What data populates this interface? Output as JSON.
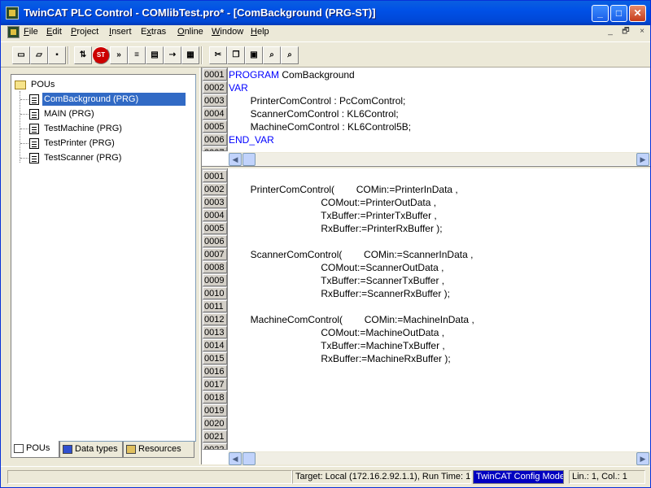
{
  "window": {
    "title": "TwinCAT PLC Control - COMlibTest.pro* - [ComBackground (PRG-ST)]",
    "controls": {
      "minimize": "_",
      "maximize": "□",
      "close": "✕"
    }
  },
  "menu": {
    "items": [
      "File",
      "Edit",
      "Project",
      "Insert",
      "Extras",
      "Online",
      "Window",
      "Help"
    ],
    "mnemonics": [
      "F",
      "E",
      "P",
      "I",
      "x",
      "O",
      "W",
      "H"
    ],
    "mdi_controls": {
      "minimize": "_",
      "restore": "🗗",
      "close": "×"
    }
  },
  "toolbar": {
    "buttons": [
      {
        "name": "new",
        "glyph": "▭"
      },
      {
        "name": "open",
        "glyph": "▱"
      },
      {
        "name": "save",
        "glyph": "▪"
      },
      {
        "name": "login",
        "glyph": "⇅"
      },
      {
        "name": "stop",
        "glyph": "ST"
      },
      {
        "name": "run",
        "glyph": "»"
      },
      {
        "name": "step",
        "glyph": "≡"
      },
      {
        "name": "breakpoint",
        "glyph": "▤"
      },
      {
        "name": "logout",
        "glyph": "⇢"
      },
      {
        "name": "download",
        "glyph": "▦"
      },
      {
        "name": "cut",
        "glyph": "✂"
      },
      {
        "name": "copy",
        "glyph": "❐"
      },
      {
        "name": "paste",
        "glyph": "▣"
      },
      {
        "name": "find",
        "glyph": "⌕"
      },
      {
        "name": "find-next",
        "glyph": "⌕"
      }
    ]
  },
  "tree": {
    "root": "POUs",
    "items": [
      {
        "label": "ComBackground (PRG)",
        "selected": true
      },
      {
        "label": "MAIN (PRG)",
        "selected": false
      },
      {
        "label": "TestMachine (PRG)",
        "selected": false
      },
      {
        "label": "TestPrinter (PRG)",
        "selected": false
      },
      {
        "label": "TestScanner (PRG)",
        "selected": false
      }
    ]
  },
  "tabs": [
    {
      "label": "POUs",
      "active": true
    },
    {
      "label": "Data types",
      "active": false
    },
    {
      "label": "Resources",
      "active": false
    }
  ],
  "declaration": {
    "line_numbers": [
      "0001",
      "0002",
      "0003",
      "0004",
      "0005",
      "0006",
      "0007"
    ],
    "lines": [
      {
        "kw": "PROGRAM",
        "text": " ComBackground"
      },
      {
        "kw": "VAR",
        "text": ""
      },
      {
        "kw": "",
        "text": "        PrinterComControl : PcComControl;"
      },
      {
        "kw": "",
        "text": "        ScannerComControl : KL6Control;"
      },
      {
        "kw": "",
        "text": "        MachineComControl : KL6Control5B;"
      },
      {
        "kw": "END_VAR",
        "text": ""
      },
      {
        "kw": "",
        "text": ""
      }
    ]
  },
  "body": {
    "line_numbers": [
      "0001",
      "0002",
      "0003",
      "0004",
      "0005",
      "0006",
      "0007",
      "0008",
      "0009",
      "0010",
      "0011",
      "0012",
      "0013",
      "0014",
      "0015",
      "0016",
      "0017",
      "0018",
      "0019",
      "0020",
      "0021",
      "0022"
    ],
    "lines": [
      "",
      "        PrinterComControl(        COMin:=PrinterInData ,",
      "                                  COMout:=PrinterOutData ,",
      "                                  TxBuffer:=PrinterTxBuffer ,",
      "                                  RxBuffer:=PrinterRxBuffer );",
      "",
      "        ScannerComControl(        COMin:=ScannerInData ,",
      "                                  COMout:=ScannerOutData ,",
      "                                  TxBuffer:=ScannerTxBuffer ,",
      "                                  RxBuffer:=ScannerRxBuffer );",
      "",
      "        MachineComControl(        COMin:=MachineInData ,",
      "                                  COMout:=MachineOutData ,",
      "                                  TxBuffer:=MachineTxBuffer ,",
      "                                  RxBuffer:=MachineRxBuffer );",
      "",
      "",
      "",
      "",
      "",
      "",
      ""
    ]
  },
  "status": {
    "empty": "",
    "target": "Target: Local (172.16.2.92.1.1), Run Time: 1",
    "mode": "TwinCAT Config Mode",
    "position": "Lin.: 1, Col.: 1"
  },
  "colors": {
    "title_bar": "#0054e3",
    "selection": "#316ac5",
    "keyword": "#0000ff",
    "mode_badge": "#0000c0"
  }
}
